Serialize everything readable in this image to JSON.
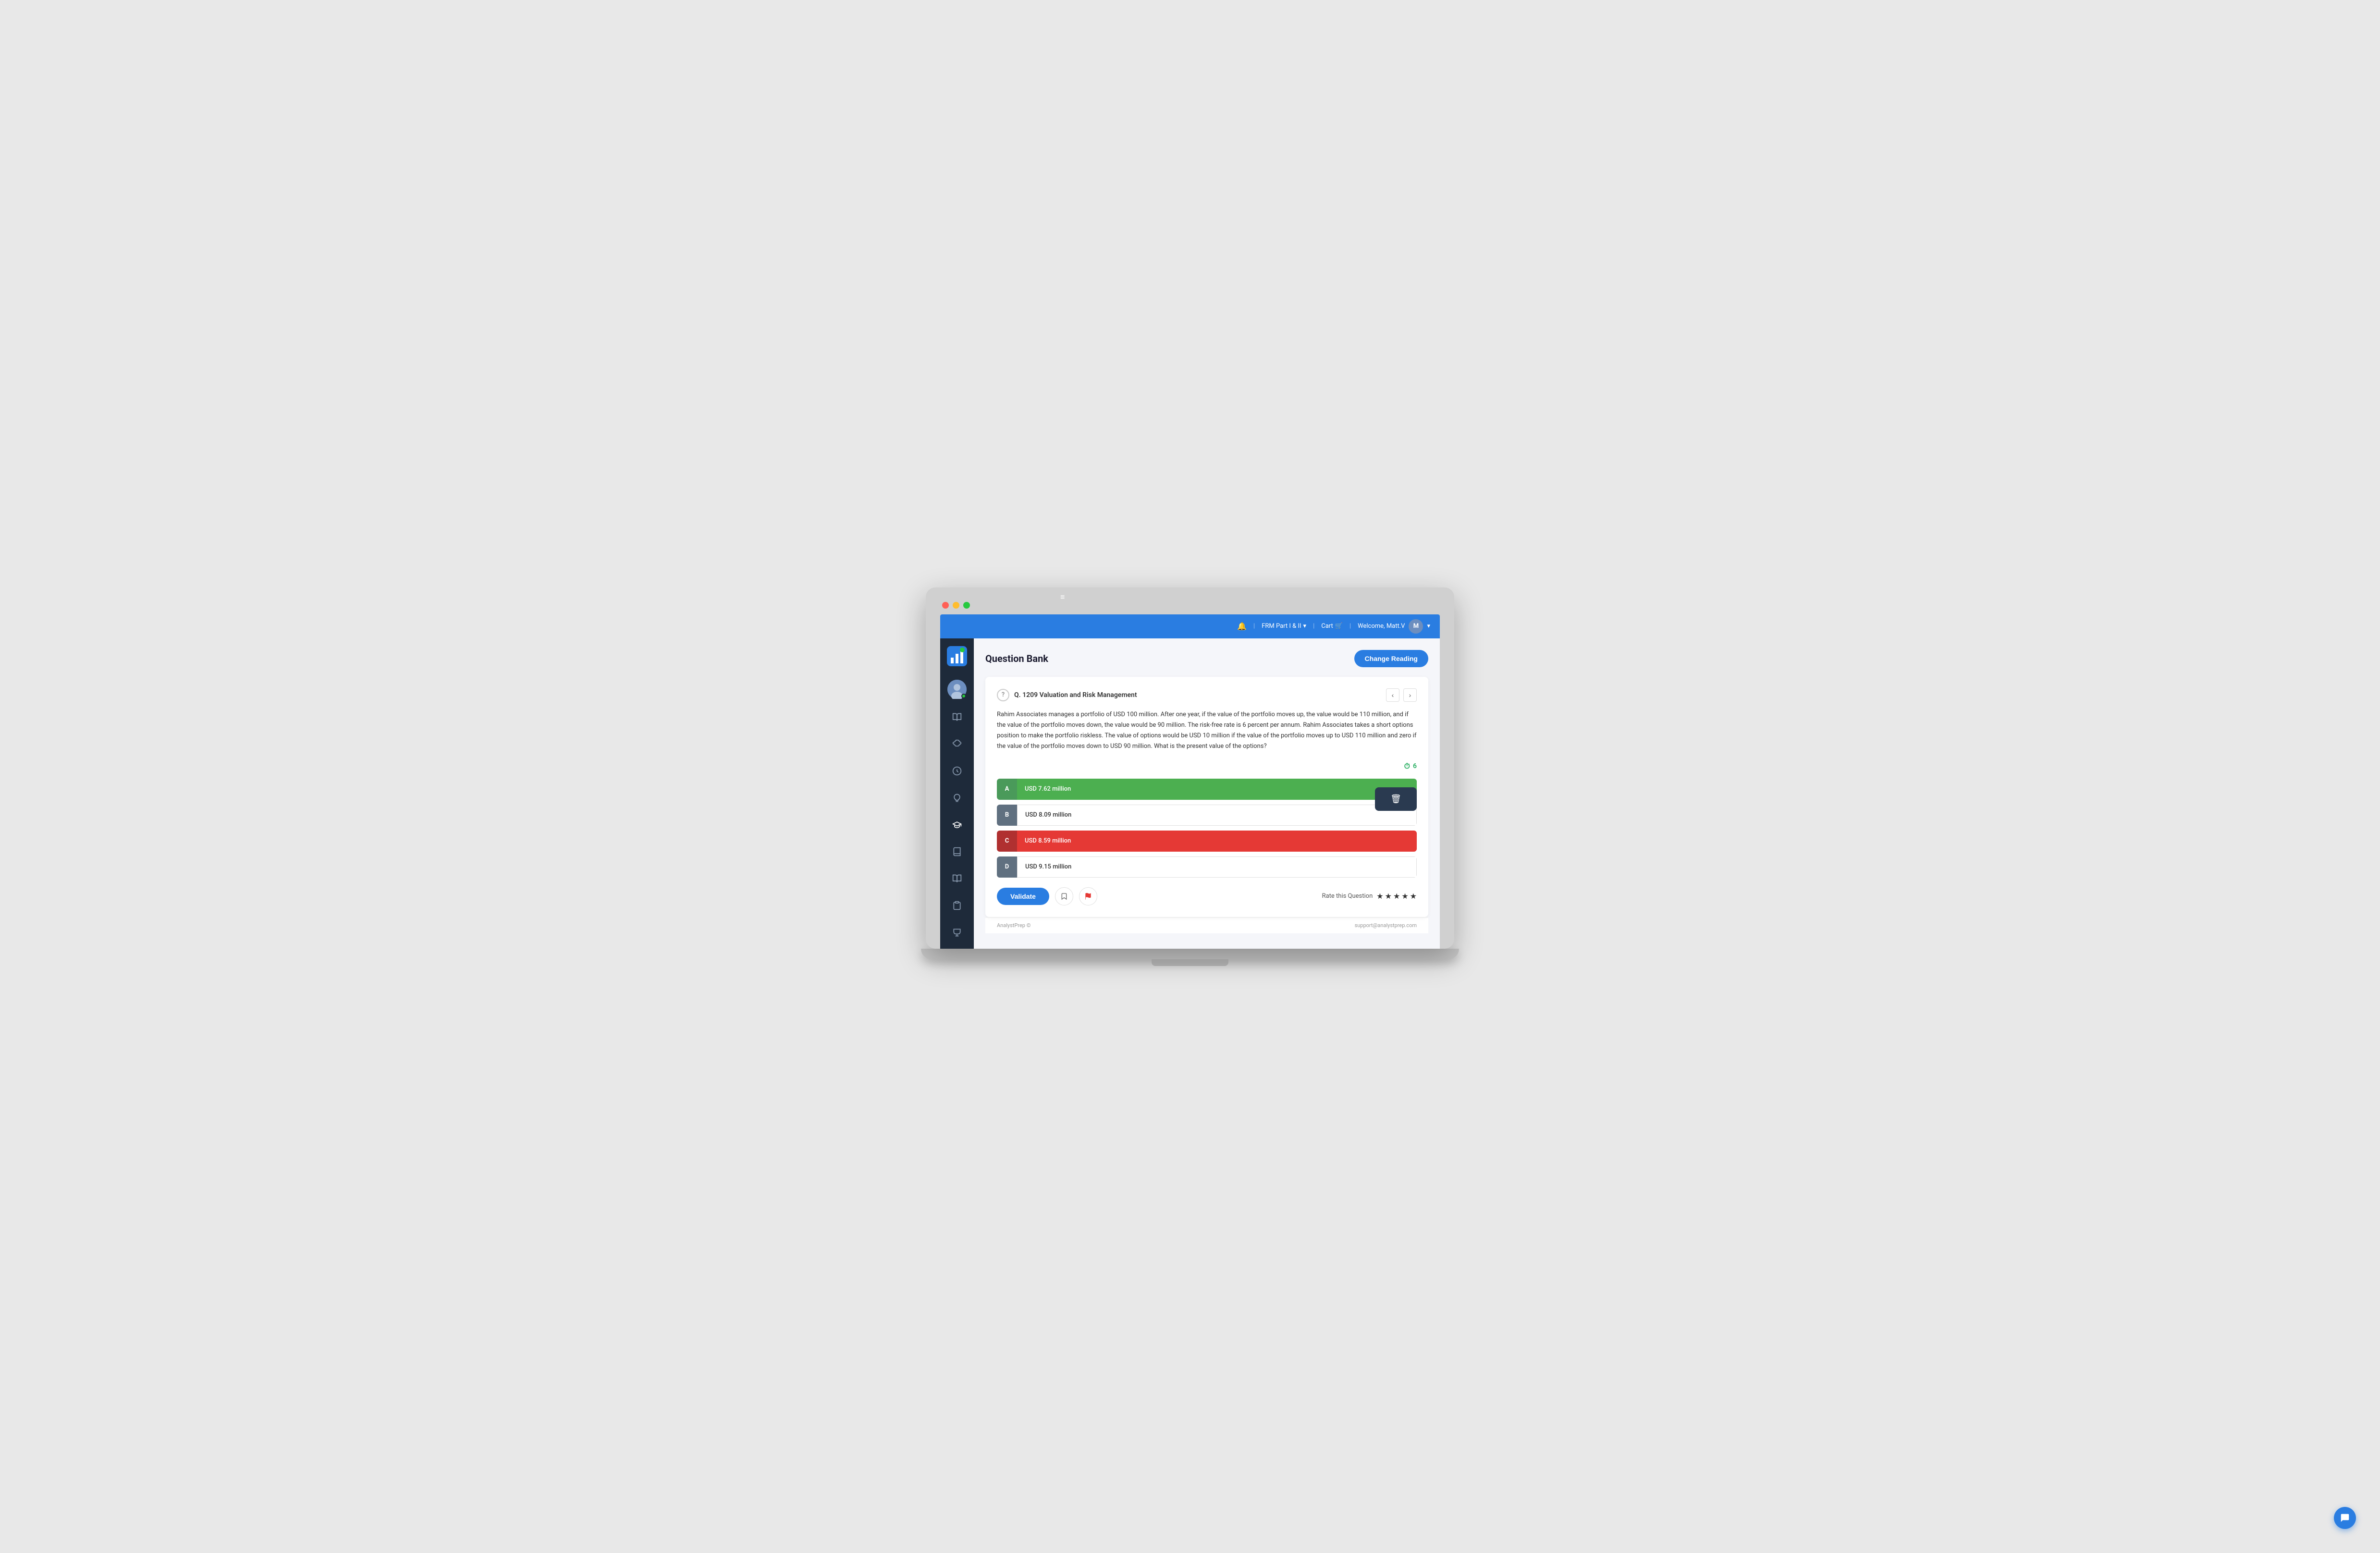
{
  "header": {
    "bell_label": "🔔",
    "frm_label": "FRM Part I & II",
    "cart_label": "Cart",
    "welcome_label": "Welcome, Matt.V",
    "hamburger": "≡"
  },
  "sidebar": {
    "logo_text": "📊",
    "items": [
      {
        "name": "dashboard",
        "icon": "📊"
      },
      {
        "name": "book",
        "icon": "📖"
      },
      {
        "name": "brain",
        "icon": "🧠"
      },
      {
        "name": "brain2",
        "icon": "🧬"
      },
      {
        "name": "lightbulb",
        "icon": "💡"
      },
      {
        "name": "graduation",
        "icon": "🎓"
      },
      {
        "name": "notebook",
        "icon": "📓"
      },
      {
        "name": "book2",
        "icon": "📚"
      },
      {
        "name": "clipboard",
        "icon": "📋"
      },
      {
        "name": "trophy",
        "icon": "🏆"
      }
    ]
  },
  "page": {
    "title": "Question Bank",
    "change_reading_btn": "Change Reading"
  },
  "question": {
    "number": "Q. 1209 Valuation and Risk Management",
    "body": "Rahim Associates manages a portfolio of USD 100 million. After one year, if the value of the portfolio moves up, the value would be 110 million, and if the value of the portfolio moves down, the value would be 90 million. The risk-free rate is 6 percent per annum. Rahim Associates takes a short options position to make the portfolio riskless. The value of options would be USD 10 million if the value of the portfolio moves up to USD 110 million and zero if the value of the portfolio moves down to USD 90 million. What is the present value of the options?",
    "timer": "6",
    "options": [
      {
        "letter": "A",
        "text": "USD 7.62 million",
        "state": "correct"
      },
      {
        "letter": "B",
        "text": "USD 8.09 million",
        "state": "neutral"
      },
      {
        "letter": "C",
        "text": "USD 8.59 million",
        "state": "incorrect"
      },
      {
        "letter": "D",
        "text": "USD 9.15 million",
        "state": "neutral"
      }
    ],
    "validate_btn": "Validate",
    "rating_label": "Rate this Question",
    "stars": [
      "★",
      "★",
      "★",
      "★",
      "★"
    ]
  },
  "footer": {
    "copyright": "AnalystPrep ©",
    "email": "support@analystprep.com"
  },
  "icons": {
    "bookmark": "🔖",
    "flag": "🚩",
    "delete": "🗑",
    "chat": "💬"
  }
}
